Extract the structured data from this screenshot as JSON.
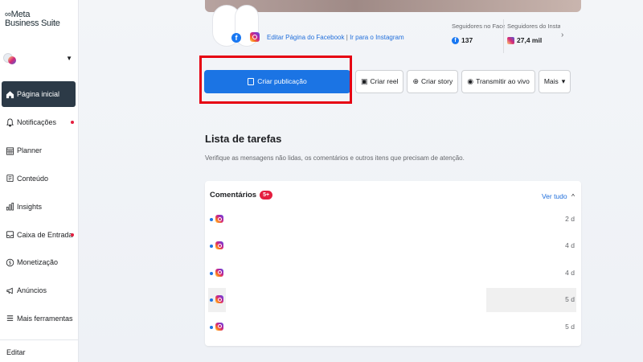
{
  "app": {
    "brand_mark": "∞Meta",
    "brand_line2": "Business Suite"
  },
  "account": {
    "caret": "▼"
  },
  "nav": [
    {
      "label": "Página inicial",
      "icon": "home-icon",
      "active": true,
      "dot": false
    },
    {
      "label": "Notificações",
      "icon": "bell-icon",
      "active": false,
      "dot": true
    },
    {
      "label": "Planner",
      "icon": "calendar-icon",
      "active": false,
      "dot": false
    },
    {
      "label": "Conteúdo",
      "icon": "document-icon",
      "active": false,
      "dot": false
    },
    {
      "label": "Insights",
      "icon": "chart-icon",
      "active": false,
      "dot": false
    },
    {
      "label": "Caixa de Entrada",
      "icon": "inbox-icon",
      "active": false,
      "dot": true
    },
    {
      "label": "Monetização",
      "icon": "dollar-icon",
      "active": false,
      "dot": false
    },
    {
      "label": "Anúncios",
      "icon": "megaphone-icon",
      "active": false,
      "dot": false
    },
    {
      "label": "Mais ferramentas",
      "icon": "menu-icon",
      "active": false,
      "dot": false
    }
  ],
  "sidebar_footer": {
    "edit_label": "Editar"
  },
  "profile": {
    "edit_fb_link": "Editar Página do Facebook",
    "separator": "|",
    "ig_link": "Ir para o Instagram"
  },
  "stats": [
    {
      "label": "Seguidores no Face...",
      "value": "137",
      "icon": "facebook-icon"
    },
    {
      "label": "Seguidores do Insta...",
      "value": "27,4 mil",
      "icon": "instagram-icon"
    }
  ],
  "stats_chevron": "›",
  "actions": {
    "create_post": "Criar publicação",
    "create_reel": "Criar reel",
    "create_story": "Criar story",
    "live": "Transmitir ao vivo",
    "more": "Mais",
    "more_caret": "▾"
  },
  "tasks": {
    "title": "Lista de tarefas",
    "subtitle": "Verifique as mensagens não lidas, os comentários e outros itens que precisam de atenção."
  },
  "comments": {
    "title": "Comentários",
    "badge": "5+",
    "see_all": "Ver tudo",
    "see_all_caret": "^",
    "rows": [
      {
        "time": "2 d"
      },
      {
        "time": "4 d"
      },
      {
        "time": "4 d"
      },
      {
        "time": "5 d"
      },
      {
        "time": "5 d"
      }
    ]
  },
  "colors": {
    "primary": "#1b74e4",
    "highlight": "#e60012",
    "sidebar_active": "#2c3a47",
    "notification": "#e41e3f"
  }
}
